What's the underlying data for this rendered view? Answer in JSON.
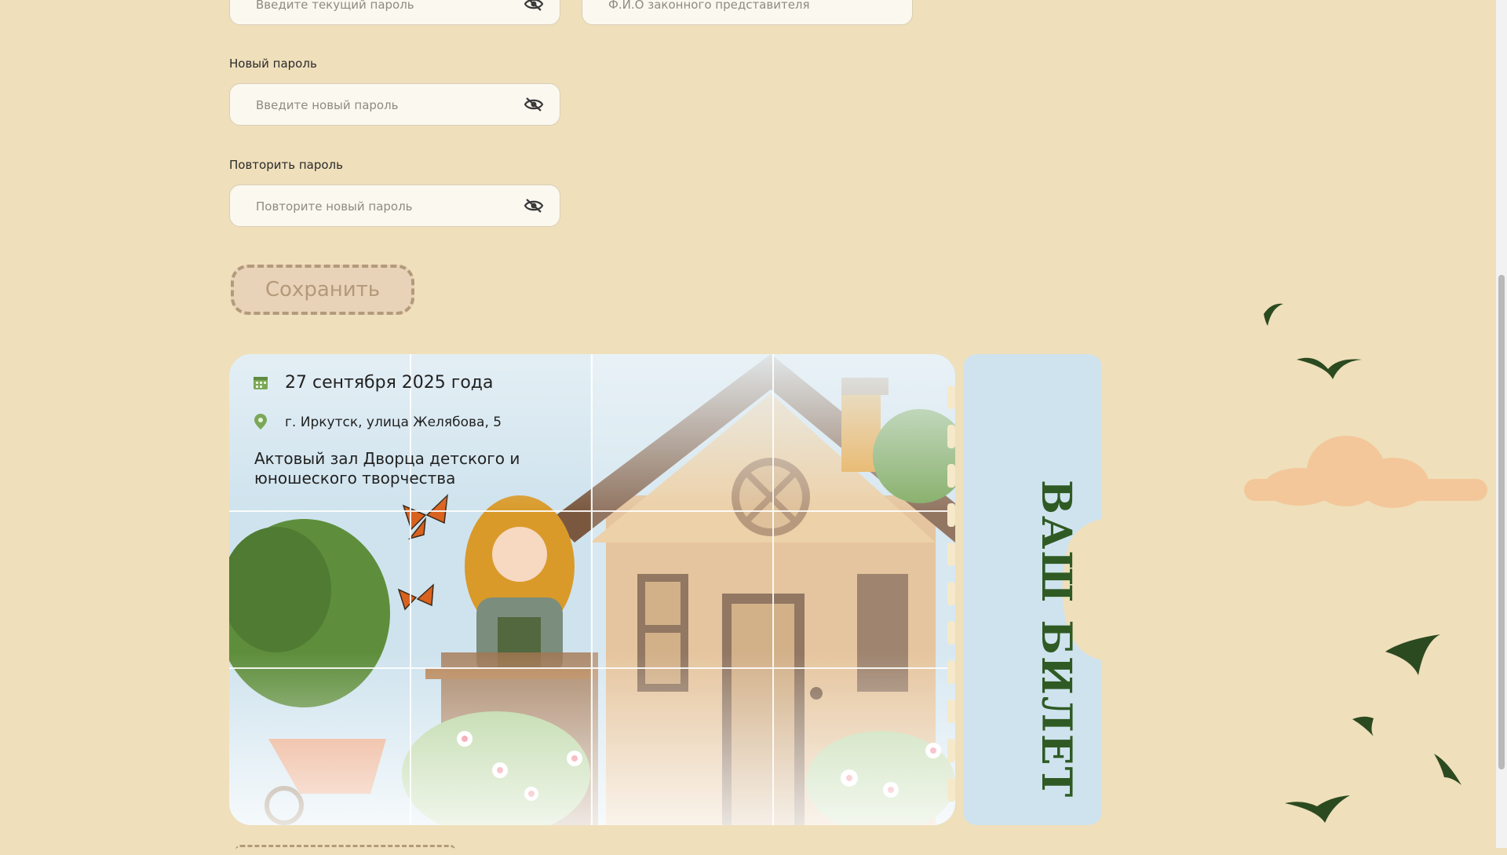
{
  "form": {
    "current_password": {
      "placeholder": "Введите текущий пароль"
    },
    "guardian_name": {
      "placeholder": "Ф.И.О законного представителя"
    },
    "new_password": {
      "label": "Новый пароль",
      "placeholder": "Введите новый пароль"
    },
    "repeat_password": {
      "label": "Повторить пароль",
      "placeholder": "Повторите новый пароль"
    },
    "save_label": "Сохранить"
  },
  "ticket": {
    "date": "27 сентября 2025 года",
    "address": "г. Иркутск, улица Желябова, 5",
    "venue": "Актовый зал Дворца детского и юношеского творчества",
    "stub_label": "ВАШ БИЛЕТ",
    "icons": {
      "date": "calendar-icon",
      "address": "location-pin-icon"
    }
  },
  "colors": {
    "background": "#efdfbb",
    "accent_green": "#2f5a24",
    "ticket_sky": "#cfe3ee",
    "save_button_border": "#b39a7a"
  }
}
